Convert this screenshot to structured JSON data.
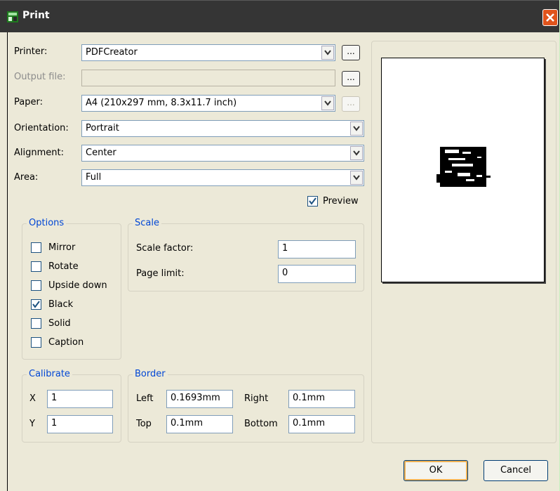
{
  "window": {
    "title": "Print"
  },
  "printer": {
    "label": "Printer:",
    "value": "PDFCreator",
    "browse": "..."
  },
  "output": {
    "label": "Output file:",
    "value": "",
    "browse": "..."
  },
  "paper": {
    "label": "Paper:",
    "value": "A4 (210x297 mm, 8.3x11.7 inch)",
    "browse": "..."
  },
  "orientation": {
    "label": "Orientation:",
    "value": "Portrait"
  },
  "alignment": {
    "label": "Alignment:",
    "value": "Center"
  },
  "area": {
    "label": "Area:",
    "value": "Full"
  },
  "preview_check": {
    "label": "Preview",
    "checked": true
  },
  "options": {
    "title": "Options",
    "items": [
      {
        "label": "Mirror",
        "checked": false
      },
      {
        "label": "Rotate",
        "checked": false
      },
      {
        "label": "Upside down",
        "checked": false
      },
      {
        "label": "Black",
        "checked": true
      },
      {
        "label": "Solid",
        "checked": false
      },
      {
        "label": "Caption",
        "checked": false
      }
    ]
  },
  "scale": {
    "title": "Scale",
    "factor_label": "Scale factor:",
    "factor_value": "1",
    "limit_label": "Page limit:",
    "limit_value": "0"
  },
  "calibrate": {
    "title": "Calibrate",
    "x_label": "X",
    "x_value": "1",
    "y_label": "Y",
    "y_value": "1"
  },
  "border": {
    "title": "Border",
    "left_label": "Left",
    "left_value": "0.1693mm",
    "right_label": "Right",
    "right_value": "0.1mm",
    "top_label": "Top",
    "top_value": "0.1mm",
    "bottom_label": "Bottom",
    "bottom_value": "0.1mm"
  },
  "buttons": {
    "ok": "OK",
    "cancel": "Cancel"
  },
  "colors": {
    "titlebar": "#353535",
    "dialog": "#ece9d8",
    "group_title": "#0046d5",
    "close": "#e0541c",
    "outer": "#c8f0c0"
  }
}
